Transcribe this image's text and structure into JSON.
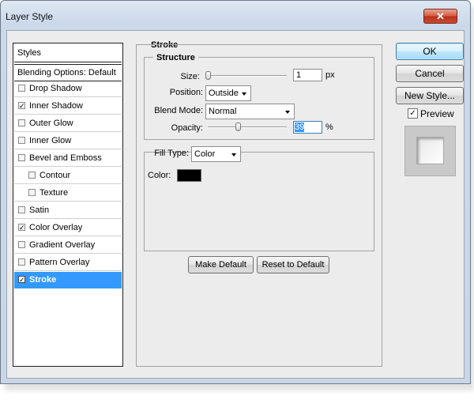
{
  "window": {
    "title": "Layer Style",
    "close_glyph": "✕"
  },
  "styles_list": {
    "header": "Styles",
    "blending_options": "Blending Options: Default",
    "items": [
      {
        "label": "Drop Shadow",
        "checked": false,
        "indent": false,
        "selected": false
      },
      {
        "label": "Inner Shadow",
        "checked": true,
        "indent": false,
        "selected": false
      },
      {
        "label": "Outer Glow",
        "checked": false,
        "indent": false,
        "selected": false
      },
      {
        "label": "Inner Glow",
        "checked": false,
        "indent": false,
        "selected": false
      },
      {
        "label": "Bevel and Emboss",
        "checked": false,
        "indent": false,
        "selected": false
      },
      {
        "label": "Contour",
        "checked": false,
        "indent": true,
        "selected": false
      },
      {
        "label": "Texture",
        "checked": false,
        "indent": true,
        "selected": false
      },
      {
        "label": "Satin",
        "checked": false,
        "indent": false,
        "selected": false
      },
      {
        "label": "Color Overlay",
        "checked": true,
        "indent": false,
        "selected": false
      },
      {
        "label": "Gradient Overlay",
        "checked": false,
        "indent": false,
        "selected": false
      },
      {
        "label": "Pattern Overlay",
        "checked": false,
        "indent": false,
        "selected": false
      },
      {
        "label": "Stroke",
        "checked": true,
        "indent": false,
        "selected": true
      }
    ]
  },
  "stroke": {
    "title": "Stroke",
    "structure": {
      "title": "Structure",
      "size_label": "Size:",
      "size_value": "1",
      "size_unit": "px",
      "position_label": "Position:",
      "position_value": "Outside",
      "blend_mode_label": "Blend Mode:",
      "blend_mode_value": "Normal",
      "opacity_label": "Opacity:",
      "opacity_value": "39",
      "opacity_unit": "%"
    },
    "fill": {
      "fill_type_label": "Fill Type:",
      "fill_type_value": "Color",
      "color_label": "Color:",
      "color_value": "#000000"
    },
    "make_default": "Make Default",
    "reset_to_default": "Reset to Default"
  },
  "buttons": {
    "ok": "OK",
    "cancel": "Cancel",
    "new_style": "New Style...",
    "preview_label": "Preview",
    "preview_checked": true
  },
  "check_glyph": "✓",
  "colors": {
    "selection": "#3399ff",
    "close": "#c94a32"
  }
}
